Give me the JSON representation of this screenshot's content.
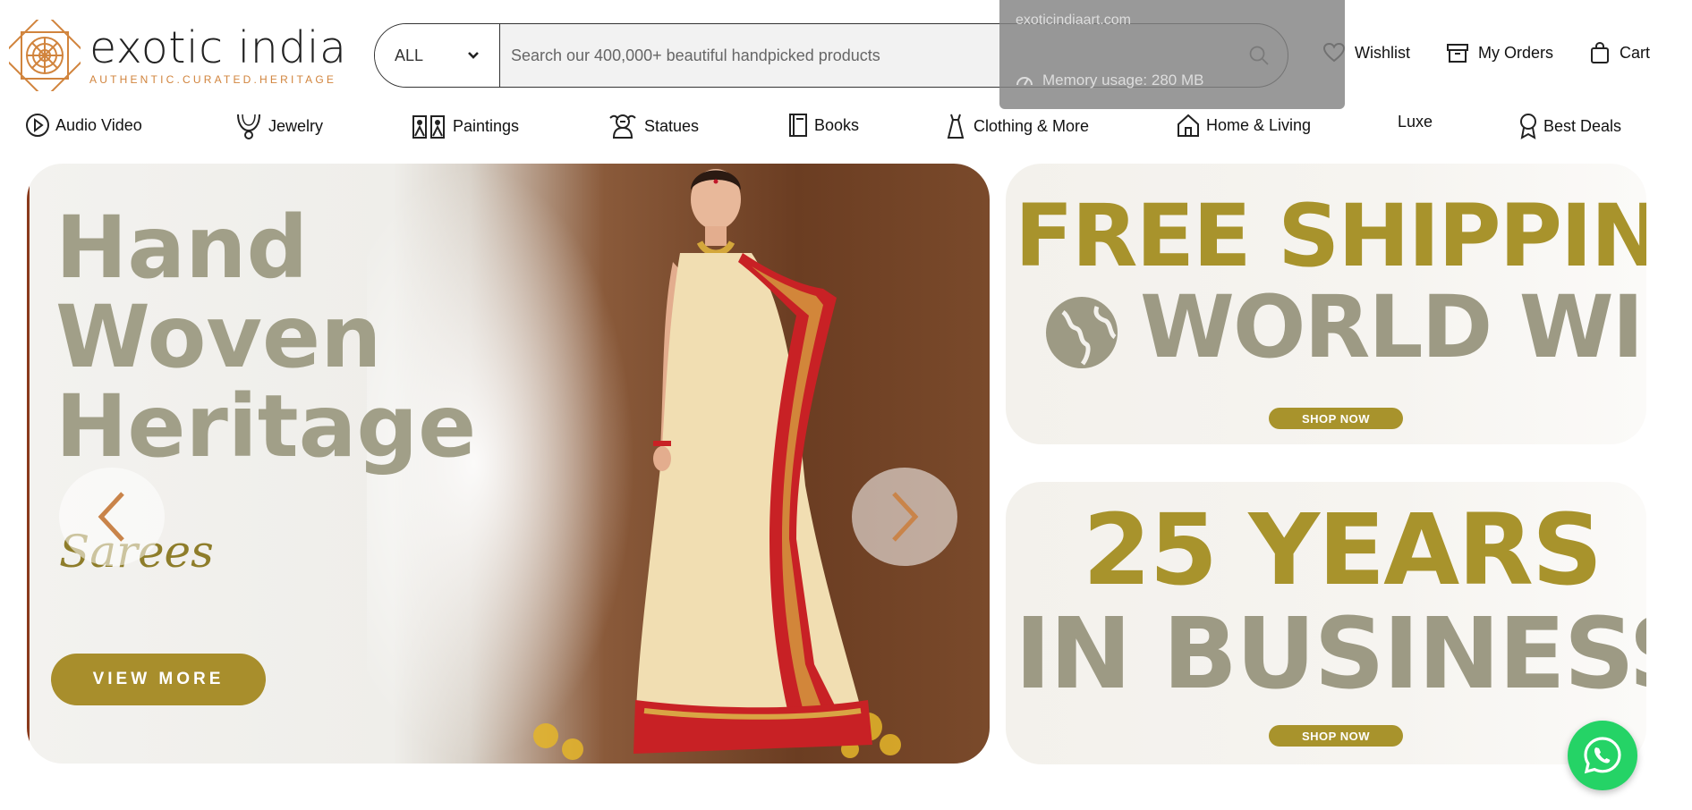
{
  "brand": {
    "title": "exotic india",
    "tagline": "AUTHENTIC.CURATED.HERITAGE",
    "accent": "#d1843d"
  },
  "search": {
    "category": "ALL",
    "placeholder": "Search our 400,000+ beautiful handpicked products"
  },
  "header_actions": {
    "wishlist": "Wishlist",
    "orders": "My Orders",
    "cart": "Cart"
  },
  "tooltip": {
    "url": "exoticindiaart.com",
    "memory": "Memory usage: 280 MB"
  },
  "nav": {
    "items": [
      {
        "label": "Audio Video",
        "icon": "play-circle-icon"
      },
      {
        "label": "Jewelry",
        "icon": "necklace-icon"
      },
      {
        "label": "Paintings",
        "icon": "paintings-icon"
      },
      {
        "label": "Statues",
        "icon": "statue-icon"
      },
      {
        "label": "Books",
        "icon": "book-icon"
      },
      {
        "label": "Clothing & More",
        "icon": "dress-icon"
      },
      {
        "label": "Home & Living",
        "icon": "home-icon"
      },
      {
        "label": "Luxe",
        "icon": ""
      },
      {
        "label": "Best Deals",
        "icon": "award-icon"
      }
    ]
  },
  "hero": {
    "heading_line1": "Hand",
    "heading_line2": "Woven",
    "heading_line3": "Heritage",
    "script": "Sarees",
    "cta": "VIEW MORE"
  },
  "banner1": {
    "line1": "FREE SHIPPING",
    "line2": "WORLD WIDE",
    "cta": "SHOP NOW"
  },
  "banner2": {
    "line1": "25 YEARS",
    "line2": "IN BUSINESS",
    "cta": "SHOP NOW"
  },
  "colors": {
    "gold": "#a8932c",
    "grey_text": "#9d9a84",
    "whatsapp": "#25d366"
  }
}
